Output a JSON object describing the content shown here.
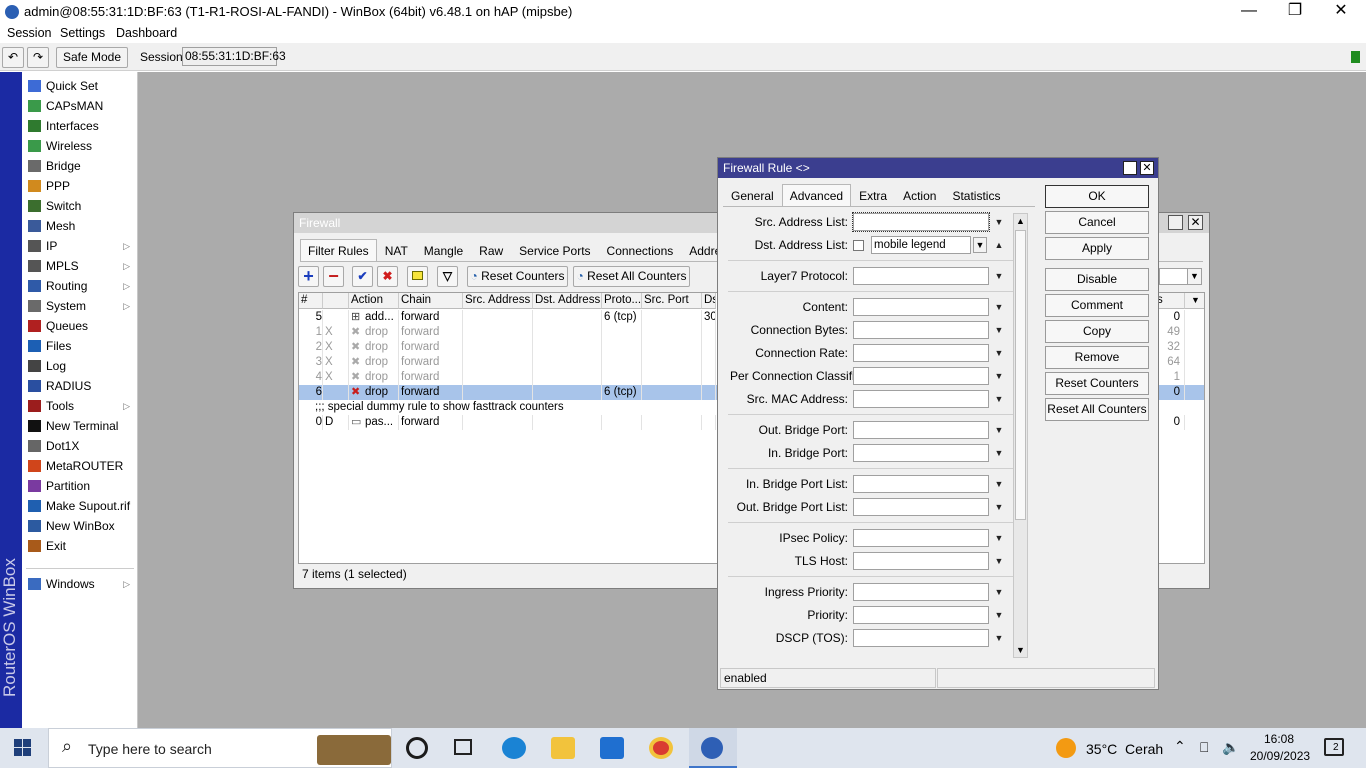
{
  "window": {
    "title": "admin@08:55:31:1D:BF:63 (T1-R1-ROSI-AL-FANDI) - WinBox (64bit) v6.48.1 on hAP (mipsbe)",
    "controls": {
      "minimize": "—",
      "maximize": "❐",
      "close": "✕"
    }
  },
  "menu": [
    "Session",
    "Settings",
    "Dashboard"
  ],
  "toolbar": {
    "undo": "↶",
    "redo": "↷",
    "safe_mode": "Safe Mode",
    "session_label": "Session:",
    "session_value": "08:55:31:1D:BF:63"
  },
  "brand": "RouterOS WinBox",
  "sidebar": {
    "items": [
      {
        "label": "Quick Set",
        "icon": "wand-icon",
        "submenu": false
      },
      {
        "label": "CAPsMAN",
        "icon": "antenna-icon",
        "submenu": false
      },
      {
        "label": "Interfaces",
        "icon": "interfaces-icon",
        "submenu": false
      },
      {
        "label": "Wireless",
        "icon": "wireless-icon",
        "submenu": false
      },
      {
        "label": "Bridge",
        "icon": "bridge-icon",
        "submenu": false
      },
      {
        "label": "PPP",
        "icon": "ppp-icon",
        "submenu": false
      },
      {
        "label": "Switch",
        "icon": "switch-icon",
        "submenu": false
      },
      {
        "label": "Mesh",
        "icon": "mesh-icon",
        "submenu": false
      },
      {
        "label": "IP",
        "icon": "ip-icon",
        "submenu": true
      },
      {
        "label": "MPLS",
        "icon": "mpls-icon",
        "submenu": true
      },
      {
        "label": "Routing",
        "icon": "routing-icon",
        "submenu": true
      },
      {
        "label": "System",
        "icon": "system-icon",
        "submenu": true
      },
      {
        "label": "Queues",
        "icon": "queues-icon",
        "submenu": false
      },
      {
        "label": "Files",
        "icon": "files-icon",
        "submenu": false
      },
      {
        "label": "Log",
        "icon": "log-icon",
        "submenu": false
      },
      {
        "label": "RADIUS",
        "icon": "radius-icon",
        "submenu": false
      },
      {
        "label": "Tools",
        "icon": "tools-icon",
        "submenu": true
      },
      {
        "label": "New Terminal",
        "icon": "terminal-icon",
        "submenu": false
      },
      {
        "label": "Dot1X",
        "icon": "dot1x-icon",
        "submenu": false
      },
      {
        "label": "MetaROUTER",
        "icon": "metarouter-icon",
        "submenu": false
      },
      {
        "label": "Partition",
        "icon": "partition-icon",
        "submenu": false
      },
      {
        "label": "Make Supout.rif",
        "icon": "supout-icon",
        "submenu": false
      },
      {
        "label": "New WinBox",
        "icon": "winbox-icon",
        "submenu": false
      },
      {
        "label": "Exit",
        "icon": "exit-icon",
        "submenu": false
      }
    ],
    "windows_item": {
      "label": "Windows",
      "icon": "windows-icon",
      "submenu": true
    }
  },
  "firewall": {
    "title": "Firewall",
    "tabs": [
      "Filter Rules",
      "NAT",
      "Mangle",
      "Raw",
      "Service Ports",
      "Connections",
      "Address Lists"
    ],
    "actions": {
      "add": "+",
      "remove": "−",
      "enable": "✔",
      "disable": "✖",
      "comment": "",
      "filter": "▽"
    },
    "reset_counters": "Reset Counters",
    "reset_all_counters": "Reset All Counters",
    "columns": [
      "#",
      "",
      "Action",
      "Chain",
      "Src. Address",
      "Dst. Address",
      "Proto...",
      "Src. Port",
      "Ds"
    ],
    "right_col_header": "s",
    "rows": [
      {
        "num": "5",
        "flag": "",
        "action": "add...",
        "chain": "forward",
        "src": "",
        "dst": "",
        "proto": "6 (tcp)",
        "sport": "",
        "dport": "30",
        "count": "0",
        "disabled": false,
        "selected": false
      },
      {
        "num": "1",
        "flag": "X",
        "action": "drop",
        "chain": "forward",
        "src": "",
        "dst": "",
        "proto": "",
        "sport": "",
        "dport": "",
        "count": "49",
        "disabled": true,
        "selected": false
      },
      {
        "num": "2",
        "flag": "X",
        "action": "drop",
        "chain": "forward",
        "src": "",
        "dst": "",
        "proto": "",
        "sport": "",
        "dport": "",
        "count": "32",
        "disabled": true,
        "selected": false
      },
      {
        "num": "3",
        "flag": "X",
        "action": "drop",
        "chain": "forward",
        "src": "",
        "dst": "",
        "proto": "",
        "sport": "",
        "dport": "",
        "count": "64",
        "disabled": true,
        "selected": false
      },
      {
        "num": "4",
        "flag": "X",
        "action": "drop",
        "chain": "forward",
        "src": "",
        "dst": "",
        "proto": "",
        "sport": "",
        "dport": "",
        "count": "1",
        "disabled": true,
        "selected": false
      },
      {
        "num": "6",
        "flag": "",
        "action": "drop",
        "chain": "forward",
        "src": "",
        "dst": "",
        "proto": "6 (tcp)",
        "sport": "",
        "dport": "",
        "count": "0",
        "disabled": false,
        "selected": true
      }
    ],
    "comment_row": ";;; special dummy rule to show fasttrack counters",
    "last_row": {
      "num": "0",
      "flag": "D",
      "action": "pas...",
      "chain": "forward",
      "count": "0"
    },
    "status": "7 items (1 selected)"
  },
  "rule": {
    "title": "Firewall Rule <>",
    "tabs": [
      "General",
      "Advanced",
      "Extra",
      "Action",
      "Statistics"
    ],
    "fields": [
      {
        "label": "Src. Address List:",
        "value": ""
      },
      {
        "label": "Dst. Address List:",
        "value": "mobile legend"
      },
      {
        "label": "Layer7 Protocol:",
        "value": ""
      },
      {
        "label": "Content:",
        "value": ""
      },
      {
        "label": "Connection Bytes:",
        "value": ""
      },
      {
        "label": "Connection Rate:",
        "value": ""
      },
      {
        "label": "Per Connection Classifier:",
        "value": ""
      },
      {
        "label": "Src. MAC Address:",
        "value": ""
      },
      {
        "label": "Out. Bridge Port:",
        "value": ""
      },
      {
        "label": "In. Bridge Port:",
        "value": ""
      },
      {
        "label": "In. Bridge Port List:",
        "value": ""
      },
      {
        "label": "Out. Bridge Port List:",
        "value": ""
      },
      {
        "label": "IPsec Policy:",
        "value": ""
      },
      {
        "label": "TLS Host:",
        "value": ""
      },
      {
        "label": "Ingress Priority:",
        "value": ""
      },
      {
        "label": "Priority:",
        "value": ""
      },
      {
        "label": "DSCP (TOS):",
        "value": ""
      }
    ],
    "buttons": [
      "OK",
      "Cancel",
      "Apply",
      "Disable",
      "Comment",
      "Copy",
      "Remove",
      "Reset Counters",
      "Reset All Counters"
    ],
    "status": "enabled"
  },
  "taskbar": {
    "search_placeholder": "Type here to search",
    "weather": "35°C  Cerah",
    "time": "16:08",
    "date": "20/09/2023",
    "notifications": "2"
  }
}
